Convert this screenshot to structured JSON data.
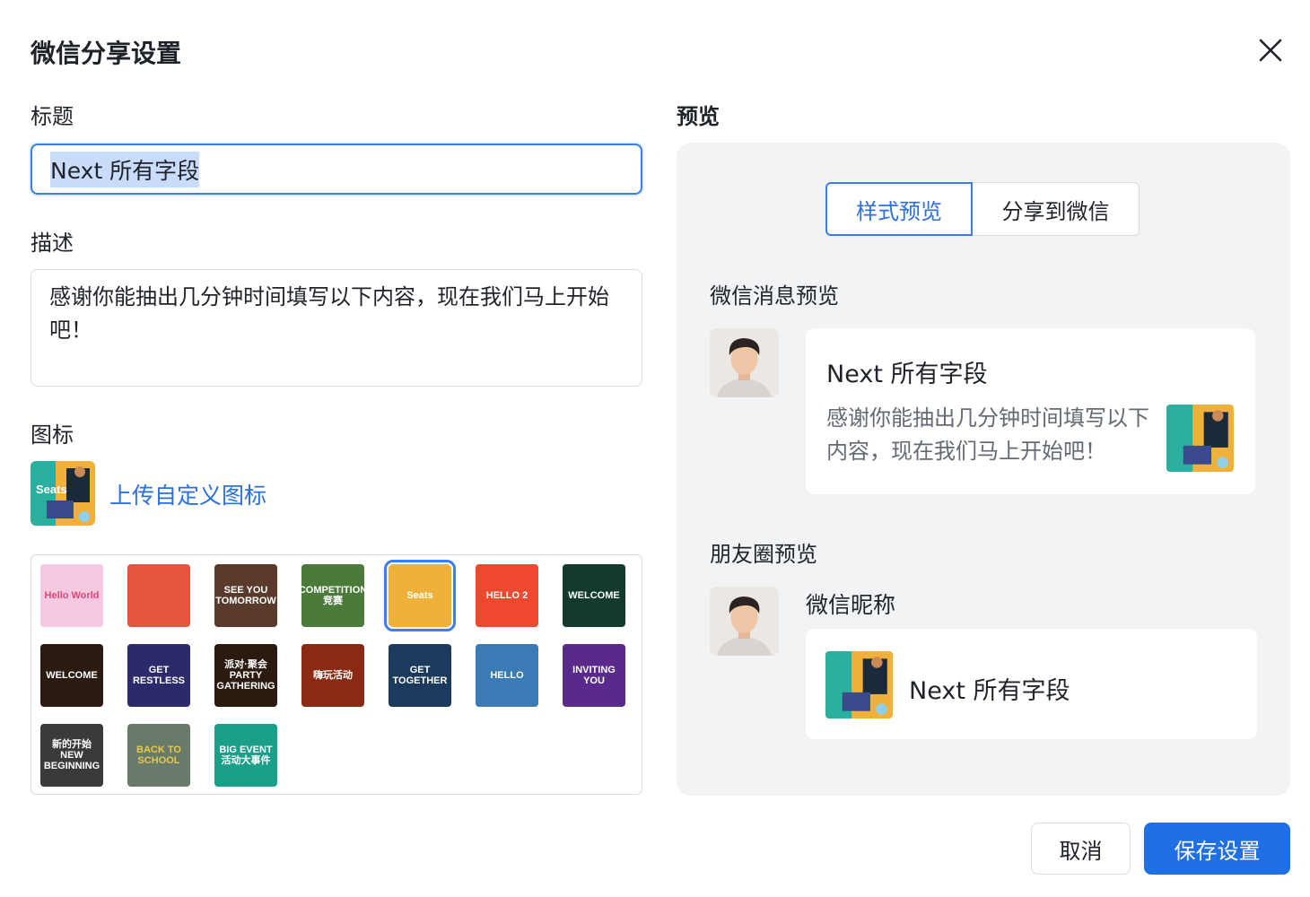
{
  "dialog": {
    "title": "微信分享设置",
    "close_icon": "close-icon"
  },
  "form": {
    "title_label": "标题",
    "title_value": "Next 所有字段",
    "description_label": "描述",
    "description_value": "感谢你能抽出几分钟时间填写以下内容，现在我们马上开始吧！",
    "icon_label": "图标",
    "upload_link": "上传自定义图标",
    "current_icon_text": "Seats"
  },
  "icon_grid": [
    {
      "name": "hello-world",
      "text": "Hello World",
      "bg": "#f5c9df",
      "color": "#e0457b",
      "selected": false
    },
    {
      "name": "running-track",
      "text": "",
      "bg": "#e5543f",
      "color": "#ffffff",
      "selected": false
    },
    {
      "name": "see-you-tomorrow",
      "text": "SEE YOU TOMORROW",
      "bg": "#5a3a2a",
      "color": "#ffffff",
      "selected": false
    },
    {
      "name": "competition",
      "text": "COMPETITION 竞赛",
      "bg": "#4b7b3a",
      "color": "#ffffff",
      "selected": false
    },
    {
      "name": "seats",
      "text": "Seats",
      "bg": "#f0b13a",
      "color": "#ffffff",
      "selected": true
    },
    {
      "name": "hello-2",
      "text": "HELLO 2",
      "bg": "#f0482e",
      "color": "#ffffff",
      "selected": false
    },
    {
      "name": "welcome-green",
      "text": "WELCOME",
      "bg": "#123b2c",
      "color": "#ffffff",
      "selected": false
    },
    {
      "name": "welcome-rainbow",
      "text": "WELCOME",
      "bg": "#2a1a12",
      "color": "#ffffff",
      "selected": false
    },
    {
      "name": "get-restless",
      "text": "GET RESTLESS",
      "bg": "#2c2a6a",
      "color": "#ffffff",
      "selected": false
    },
    {
      "name": "party-gathering",
      "text": "派对·聚会 PARTY GATHERING",
      "bg": "#2a1a10",
      "color": "#ffffff",
      "selected": false
    },
    {
      "name": "play-event",
      "text": "嗨玩活动",
      "bg": "#8a2a12",
      "color": "#ffffff",
      "selected": false
    },
    {
      "name": "get-together",
      "text": "GET TOGETHER",
      "bg": "#1c3a5c",
      "color": "#ffffff",
      "selected": false
    },
    {
      "name": "hello-cat",
      "text": "HELLO",
      "bg": "#3a7ab5",
      "color": "#ffffff",
      "selected": false
    },
    {
      "name": "invitation",
      "text": "INVITING YOU",
      "bg": "#5a2a8a",
      "color": "#ffffff",
      "selected": false
    },
    {
      "name": "new-beginning",
      "text": "新的开始 NEW BEGINNING",
      "bg": "#3a3a3a",
      "color": "#ffffff",
      "selected": false
    },
    {
      "name": "back-to-school",
      "text": "BACK TO SCHOOL",
      "bg": "#6a7a6a",
      "color": "#e8c84a",
      "selected": false
    },
    {
      "name": "big-event",
      "text": "BIG EVENT 活动大事件",
      "bg": "#1aa08a",
      "color": "#ffffff",
      "selected": false
    }
  ],
  "preview": {
    "label": "预览",
    "tabs": [
      {
        "label": "样式预览",
        "active": true
      },
      {
        "label": "分享到微信",
        "active": false
      }
    ],
    "message_section": "微信消息预览",
    "moments_section": "朋友圈预览",
    "nickname": "微信昵称",
    "card_title": "Next 所有字段",
    "card_desc": "感谢你能抽出几分钟时间填写以下内容，现在我们马上开始吧！"
  },
  "footer": {
    "cancel": "取消",
    "save": "保存设置"
  },
  "colors": {
    "accent": "#1f6fe5",
    "panel_bg": "#f2f3f5",
    "link": "#2b6fe0"
  }
}
